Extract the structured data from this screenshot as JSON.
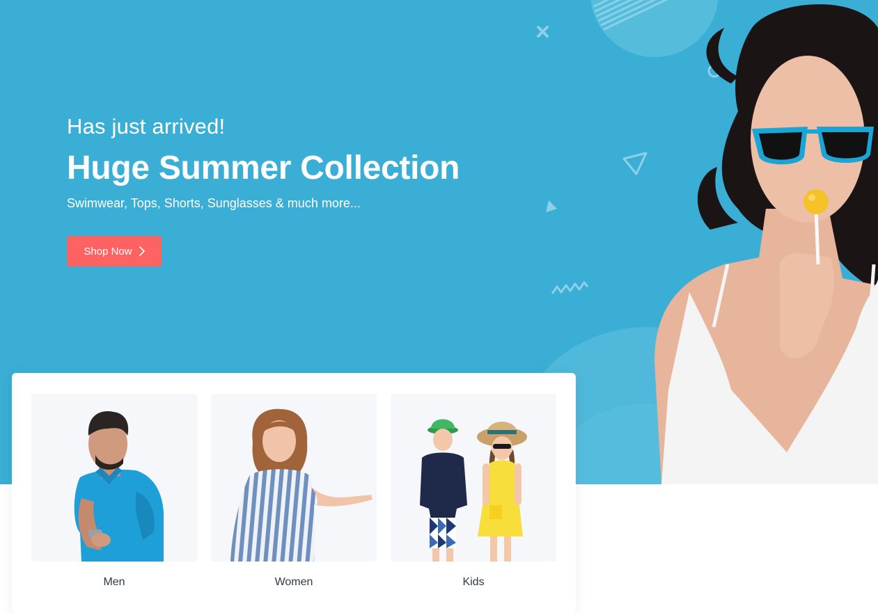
{
  "hero": {
    "kicker": "Has just arrived!",
    "title": "Huge Summer Collection",
    "subtitle": "Swimwear, Tops, Shorts, Sunglasses & much more...",
    "cta_label": "Shop Now",
    "cta_icon": "chevron-right-icon",
    "background_color": "#3aaed4",
    "cta_color": "#fd6363"
  },
  "categories": [
    {
      "label": "Men",
      "image": "man-in-blue-polo"
    },
    {
      "label": "Women",
      "image": "woman-in-striped-dress"
    },
    {
      "label": "Kids",
      "image": "two-kids-in-hats"
    }
  ]
}
